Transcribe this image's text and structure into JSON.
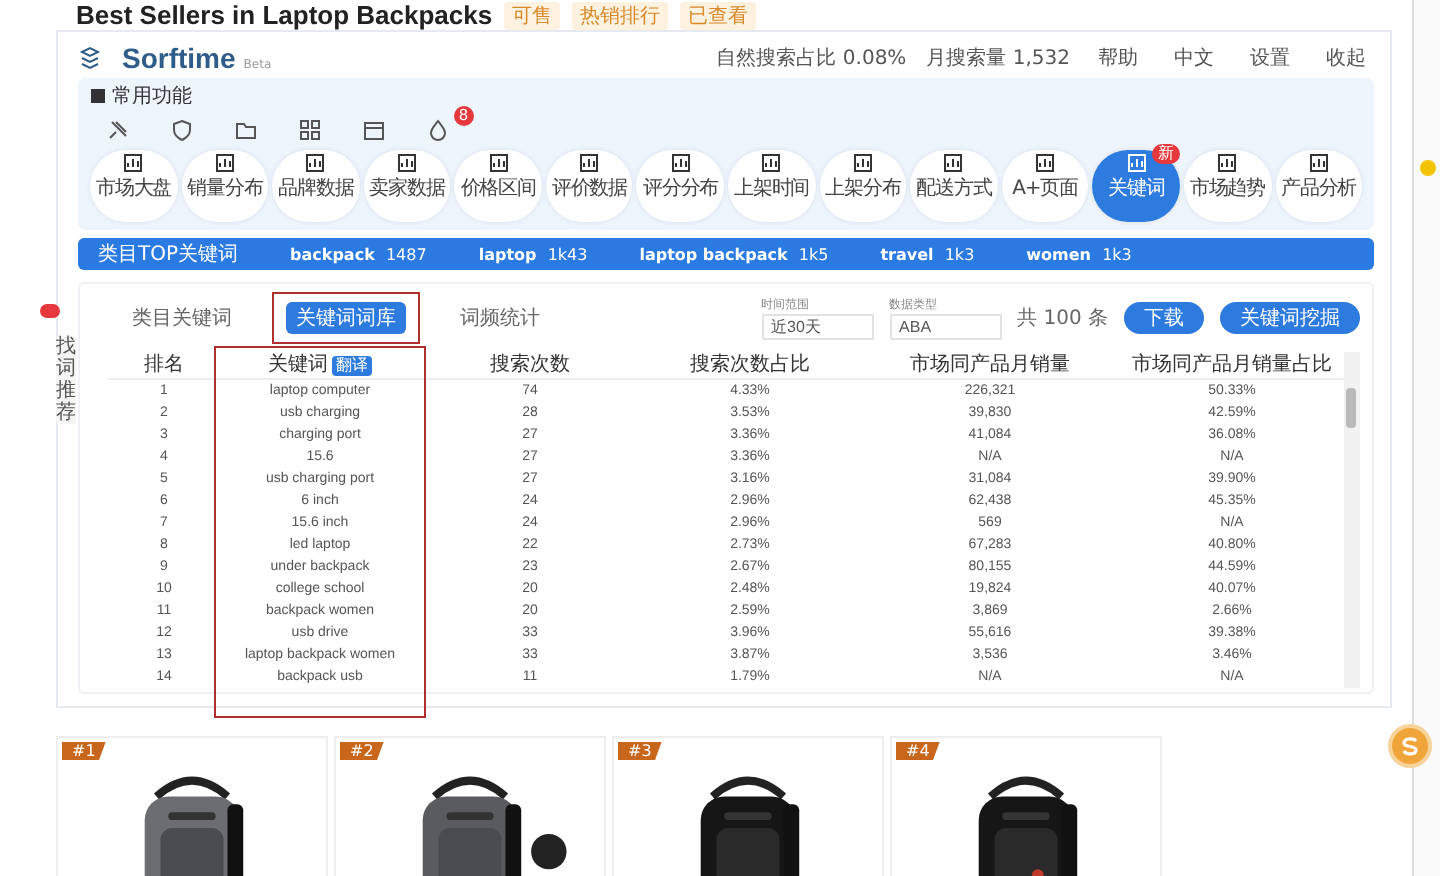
{
  "page_title": "Best Sellers in Laptop Backpacks",
  "title_tags": [
    "可售",
    "热销排行",
    "已查看"
  ],
  "brand": {
    "name": "Sorftime",
    "edition": "Beta"
  },
  "header_stats": [
    "自然搜索占比 0.08%",
    "月搜索量 1,532"
  ],
  "header_actions": [
    "帮助",
    "中文",
    "设置",
    "收起"
  ],
  "favorites_label": "常用功能",
  "toolbar_badge": "8",
  "nav": [
    {
      "label": "市场大盘",
      "selected": false
    },
    {
      "label": "销量分布",
      "selected": false
    },
    {
      "label": "品牌数据",
      "selected": false
    },
    {
      "label": "卖家数据",
      "selected": false
    },
    {
      "label": "价格区间",
      "selected": false
    },
    {
      "label": "评价数据",
      "selected": false
    },
    {
      "label": "评分分布",
      "selected": false
    },
    {
      "label": "上架时间",
      "selected": false
    },
    {
      "label": "上架分布",
      "selected": false
    },
    {
      "label": "配送方式",
      "selected": false
    },
    {
      "label": "A+页面",
      "selected": false
    },
    {
      "label": "关键词",
      "selected": true,
      "badge": "新"
    },
    {
      "label": "市场趋势",
      "selected": false
    },
    {
      "label": "产品分析",
      "selected": false
    }
  ],
  "keyword_bar": {
    "label": "类目TOP关键词",
    "keywords": [
      {
        "word": "backpack",
        "count": "1487"
      },
      {
        "word": "laptop",
        "count": "1k43"
      },
      {
        "word": "laptop backpack",
        "count": "1k5"
      },
      {
        "word": "travel",
        "count": "1k3"
      },
      {
        "word": "women",
        "count": "1k3"
      }
    ]
  },
  "side_tab": "找词推荐",
  "subtabs": [
    {
      "label": "类目关键词",
      "selected": false
    },
    {
      "label": "关键词词库",
      "selected": true
    },
    {
      "label": "词频统计",
      "selected": false
    }
  ],
  "filters": [
    {
      "label": "时间范围",
      "value": "近30天"
    },
    {
      "label": "数据类型",
      "value": "ABA"
    }
  ],
  "total": "共 100 条",
  "buttons": [
    "下载",
    "关键词挖掘"
  ],
  "table": {
    "columns": [
      {
        "label": "排名"
      },
      {
        "label": "关键词",
        "badge": "翻译"
      },
      {
        "label": "搜索次数"
      },
      {
        "label": "搜索次数占比"
      },
      {
        "label": "市场同产品月销量"
      },
      {
        "label": "市场同产品月销量占比"
      }
    ],
    "rows": [
      [
        "1",
        "laptop computer",
        "74",
        "4.33%",
        "226,321",
        "50.33%"
      ],
      [
        "2",
        "usb charging",
        "28",
        "3.53%",
        "39,830",
        "42.59%"
      ],
      [
        "3",
        "charging port",
        "27",
        "3.36%",
        "41,084",
        "36.08%"
      ],
      [
        "4",
        "15.6",
        "27",
        "3.36%",
        "N/A",
        "N/A"
      ],
      [
        "5",
        "usb charging port",
        "27",
        "3.16%",
        "31,084",
        "39.90%"
      ],
      [
        "6",
        "6 inch",
        "24",
        "2.96%",
        "62,438",
        "45.35%"
      ],
      [
        "7",
        "15.6 inch",
        "24",
        "2.96%",
        "569",
        "N/A"
      ],
      [
        "8",
        "led laptop",
        "22",
        "2.73%",
        "67,283",
        "40.80%"
      ],
      [
        "9",
        "under backpack",
        "23",
        "2.67%",
        "80,155",
        "44.59%"
      ],
      [
        "10",
        "college school",
        "20",
        "2.48%",
        "19,824",
        "40.07%"
      ],
      [
        "11",
        "backpack women",
        "20",
        "2.59%",
        "3,869",
        "2.66%"
      ],
      [
        "12",
        "usb drive",
        "33",
        "3.96%",
        "55,616",
        "39.38%"
      ],
      [
        "13",
        "laptop backpack women",
        "33",
        "3.87%",
        "3,536",
        "3.46%"
      ],
      [
        "14",
        "backpack usb",
        "11",
        "1.79%",
        "N/A",
        "N/A"
      ]
    ]
  },
  "products": [
    {
      "rank": "#1"
    },
    {
      "rank": "#2"
    },
    {
      "rank": "#3"
    },
    {
      "rank": "#4"
    }
  ]
}
